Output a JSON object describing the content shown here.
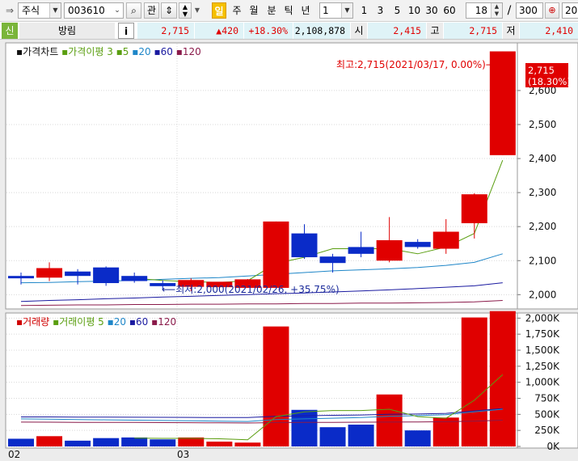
{
  "toolbar": {
    "market": "주식",
    "code": "003610",
    "watch_label": "관",
    "period_tabs": [
      "일",
      "주",
      "월",
      "분",
      "틱",
      "년"
    ],
    "active_period": "일",
    "interval_value": "1",
    "interval_buttons": [
      "1",
      "3",
      "5",
      "10",
      "30",
      "60"
    ],
    "count_value": "18",
    "separator": "/",
    "total_value": "300",
    "right_edge_value": "20"
  },
  "info": {
    "type_badge": "신",
    "name": "방림",
    "info_button": "i",
    "price": "2,715",
    "change": "▲420",
    "change_pct": "+18.30%",
    "volume": "2,108,878",
    "open_label": "시",
    "open": "2,415",
    "high_label": "고",
    "high": "2,715",
    "low_label": "저",
    "low": "2,410"
  },
  "colors": {
    "up": "#e00000",
    "down": "#0a2bc8",
    "ma5": "#5a9e10",
    "ma20": "#1e86c8",
    "ma60": "#1a1aa0",
    "ma120": "#8a1a4a"
  },
  "price_panel": {
    "title": "가격차트",
    "legend": [
      {
        "label": "가격이평 3",
        "color": "#5a9e10"
      },
      {
        "label": "5",
        "color": "#5a9e10"
      },
      {
        "label": "20",
        "color": "#1e86c8"
      },
      {
        "label": "60",
        "color": "#1a1aa0"
      },
      {
        "label": "120",
        "color": "#8a1a4a"
      }
    ],
    "high_note": "최고:2,715(2021/03/17, 0.00%)⟶",
    "low_note": "⟵최저:2,000(2021/02/26, +35.75%)",
    "last_price": "2,715",
    "last_pct": "(18.30%)",
    "y_ticks": [
      "2,600",
      "2,500",
      "2,400",
      "2,300",
      "2,200",
      "2,100",
      "2,000"
    ]
  },
  "volume_panel": {
    "title": "거래량",
    "legend": [
      {
        "label": "거래이평 5",
        "color": "#5a9e10"
      },
      {
        "label": "20",
        "color": "#1e86c8"
      },
      {
        "label": "60",
        "color": "#1a1aa0"
      },
      {
        "label": "120",
        "color": "#8a1a4a"
      }
    ],
    "y_ticks": [
      "2,000K",
      "1,750K",
      "1,500K",
      "1,250K",
      "1,000K",
      "750K",
      "500K",
      "250K",
      "0K"
    ]
  },
  "x_labels": [
    "02",
    "03"
  ],
  "chart_data": {
    "type": "candlestick",
    "candles": [
      {
        "o": 2055,
        "h": 2065,
        "l": 2030,
        "c": 2048
      },
      {
        "o": 2050,
        "h": 2095,
        "l": 2040,
        "c": 2078
      },
      {
        "o": 2068,
        "h": 2075,
        "l": 2030,
        "c": 2055
      },
      {
        "o": 2080,
        "h": 2083,
        "l": 2026,
        "c": 2034
      },
      {
        "o": 2055,
        "h": 2065,
        "l": 2035,
        "c": 2040
      },
      {
        "o": 2034,
        "h": 2042,
        "l": 2015,
        "c": 2025
      },
      {
        "o": 2023,
        "h": 2048,
        "l": 2010,
        "c": 2043
      },
      {
        "o": 2022,
        "h": 2035,
        "l": 2015,
        "c": 2038
      },
      {
        "o": 2020,
        "h": 2046,
        "l": 2020,
        "c": 2045
      },
      {
        "o": 2020,
        "h": 2215,
        "l": 2020,
        "c": 2215
      },
      {
        "o": 2180,
        "h": 2207,
        "l": 2105,
        "c": 2110
      },
      {
        "o": 2112,
        "h": 2120,
        "l": 2065,
        "c": 2093
      },
      {
        "o": 2140,
        "h": 2185,
        "l": 2110,
        "c": 2120
      },
      {
        "o": 2100,
        "h": 2228,
        "l": 2095,
        "c": 2160
      },
      {
        "o": 2155,
        "h": 2163,
        "l": 2135,
        "c": 2140
      },
      {
        "o": 2135,
        "h": 2222,
        "l": 2120,
        "c": 2185
      },
      {
        "o": 2210,
        "h": 2298,
        "l": 2165,
        "c": 2295
      },
      {
        "o": 2410,
        "h": 2715,
        "l": 2410,
        "c": 2715
      }
    ],
    "volume_k": [
      120,
      160,
      90,
      130,
      140,
      110,
      140,
      75,
      60,
      1870,
      570,
      300,
      340,
      810,
      250,
      450,
      2010,
      2109
    ],
    "ma5": [
      null,
      null,
      null,
      null,
      2048,
      2042,
      2038,
      2036,
      2041,
      2092,
      2110,
      2135,
      2135,
      2135,
      2120,
      2140,
      2180,
      2395
    ],
    "ma20": [
      2035,
      2036,
      2038,
      2040,
      2042,
      2045,
      2048,
      2050,
      2055,
      2060,
      2065,
      2070,
      2073,
      2076,
      2080,
      2086,
      2095,
      2120
    ],
    "ma60": [
      1980,
      1983,
      1985,
      1988,
      1990,
      1993,
      1995,
      1998,
      2000,
      2003,
      2005,
      2008,
      2011,
      2014,
      2018,
      2022,
      2026,
      2035
    ],
    "ma120": [
      1968,
      1969,
      1970,
      1970,
      1971,
      1971,
      1972,
      1972,
      1973,
      1973,
      1974,
      1974,
      1975,
      1975,
      1976,
      1977,
      1979,
      1983
    ],
    "vol_ma5": [
      null,
      null,
      null,
      null,
      128,
      126,
      126,
      120,
      105,
      465,
      540,
      560,
      560,
      580,
      465,
      440,
      720,
      1120
    ],
    "vol_ma20": [
      430,
      425,
      420,
      415,
      410,
      405,
      400,
      395,
      390,
      420,
      430,
      440,
      450,
      470,
      480,
      495,
      540,
      580
    ],
    "vol_ma60": [
      460,
      460,
      458,
      456,
      455,
      454,
      452,
      450,
      450,
      470,
      478,
      485,
      490,
      500,
      505,
      515,
      555,
      590
    ],
    "vol_ma120": [
      380,
      378,
      376,
      375,
      374,
      372,
      370,
      368,
      366,
      372,
      374,
      376,
      378,
      380,
      382,
      386,
      395,
      410
    ],
    "price_ylim": [
      1958,
      2740
    ],
    "volume_ylim": [
      0,
      2080
    ]
  }
}
